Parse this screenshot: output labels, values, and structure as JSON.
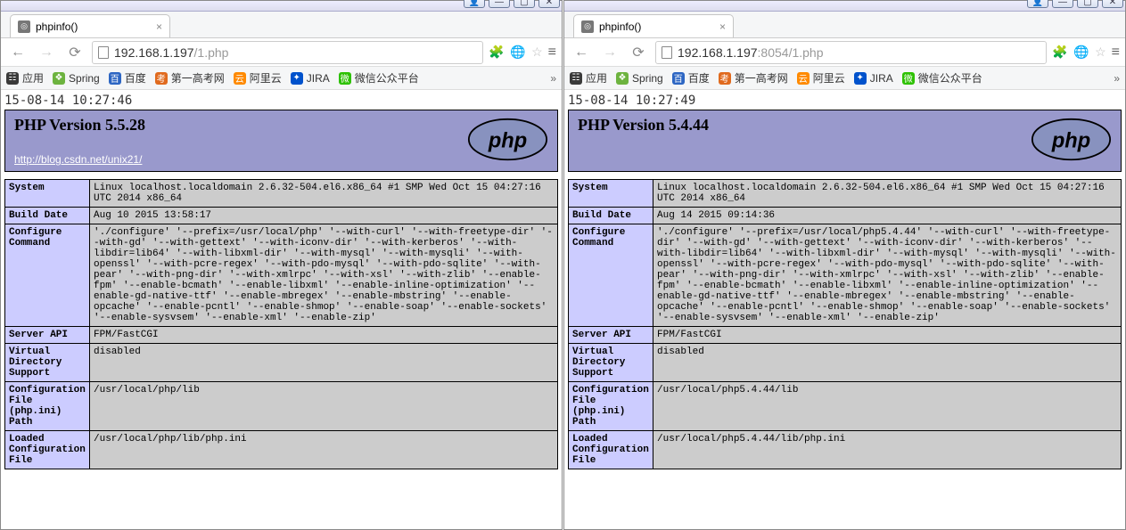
{
  "titlebar_buttons": [
    "👤",
    "—",
    "▢",
    "✕"
  ],
  "bookmarks": [
    {
      "label": "应用",
      "color": "#3a3a3a",
      "icon": "☷"
    },
    {
      "label": "Spring",
      "color": "#6db33f",
      "icon": "❖"
    },
    {
      "label": "百度",
      "color": "#2d66c3",
      "icon": "百"
    },
    {
      "label": "第一高考网",
      "color": "#e06a1e",
      "icon": "考"
    },
    {
      "label": "阿里云",
      "color": "#ff8a00",
      "icon": "云"
    },
    {
      "label": "JIRA",
      "color": "#0052cc",
      "icon": "✦"
    },
    {
      "label": "微信公众平台",
      "color": "#2dc100",
      "icon": "微"
    }
  ],
  "left": {
    "tab_title": "phpinfo()",
    "url_host": "192.168.1.197",
    "url_rest": "/1.php",
    "timestamp": "15-08-14 10:27:46",
    "version": "PHP Version 5.5.28",
    "header_url": "http://blog.csdn.net/unix21/",
    "rows": [
      {
        "k": "System",
        "v": "Linux localhost.localdomain 2.6.32-504.el6.x86_64 #1 SMP Wed Oct 15 04:27:16 UTC 2014 x86_64"
      },
      {
        "k": "Build Date",
        "v": "Aug 10 2015 13:58:17"
      },
      {
        "k": "Configure Command",
        "v": "'./configure' '--prefix=/usr/local/php' '--with-curl' '--with-freetype-dir' '--with-gd' '--with-gettext' '--with-iconv-dir' '--with-kerberos' '--with-libdir=lib64' '--with-libxml-dir' '--with-mysql' '--with-mysqli' '--with-openssl' '--with-pcre-regex' '--with-pdo-mysql' '--with-pdo-sqlite' '--with-pear' '--with-png-dir' '--with-xmlrpc' '--with-xsl' '--with-zlib' '--enable-fpm' '--enable-bcmath' '--enable-libxml' '--enable-inline-optimization' '--enable-gd-native-ttf' '--enable-mbregex' '--enable-mbstring' '--enable-opcache' '--enable-pcntl' '--enable-shmop' '--enable-soap' '--enable-sockets' '--enable-sysvsem' '--enable-xml' '--enable-zip'"
      },
      {
        "k": "Server API",
        "v": "FPM/FastCGI"
      },
      {
        "k": "Virtual Directory Support",
        "v": "disabled"
      },
      {
        "k": "Configuration File (php.ini) Path",
        "v": "/usr/local/php/lib"
      },
      {
        "k": "Loaded Configuration File",
        "v": "/usr/local/php/lib/php.ini"
      }
    ]
  },
  "right": {
    "tab_title": "phpinfo()",
    "url_host": "192.168.1.197",
    "url_port": ":8054",
    "url_rest": "/1.php",
    "timestamp": "15-08-14 10:27:49",
    "version": "PHP Version 5.4.44",
    "rows": [
      {
        "k": "System",
        "v": "Linux localhost.localdomain 2.6.32-504.el6.x86_64 #1 SMP Wed Oct 15 04:27:16 UTC 2014 x86_64"
      },
      {
        "k": "Build Date",
        "v": "Aug 14 2015 09:14:36"
      },
      {
        "k": "Configure Command",
        "v": "'./configure' '--prefix=/usr/local/php5.4.44' '--with-curl' '--with-freetype-dir' '--with-gd' '--with-gettext' '--with-iconv-dir' '--with-kerberos' '--with-libdir=lib64' '--with-libxml-dir' '--with-mysql' '--with-mysqli' '--with-openssl' '--with-pcre-regex' '--with-pdo-mysql' '--with-pdo-sqlite' '--with-pear' '--with-png-dir' '--with-xmlrpc' '--with-xsl' '--with-zlib' '--enable-fpm' '--enable-bcmath' '--enable-libxml' '--enable-inline-optimization' '--enable-gd-native-ttf' '--enable-mbregex' '--enable-mbstring' '--enable-opcache' '--enable-pcntl' '--enable-shmop' '--enable-soap' '--enable-sockets' '--enable-sysvsem' '--enable-xml' '--enable-zip'"
      },
      {
        "k": "Server API",
        "v": "FPM/FastCGI"
      },
      {
        "k": "Virtual Directory Support",
        "v": "disabled"
      },
      {
        "k": "Configuration File (php.ini) Path",
        "v": "/usr/local/php5.4.44/lib"
      },
      {
        "k": "Loaded Configuration File",
        "v": "/usr/local/php5.4.44/lib/php.ini"
      }
    ]
  }
}
